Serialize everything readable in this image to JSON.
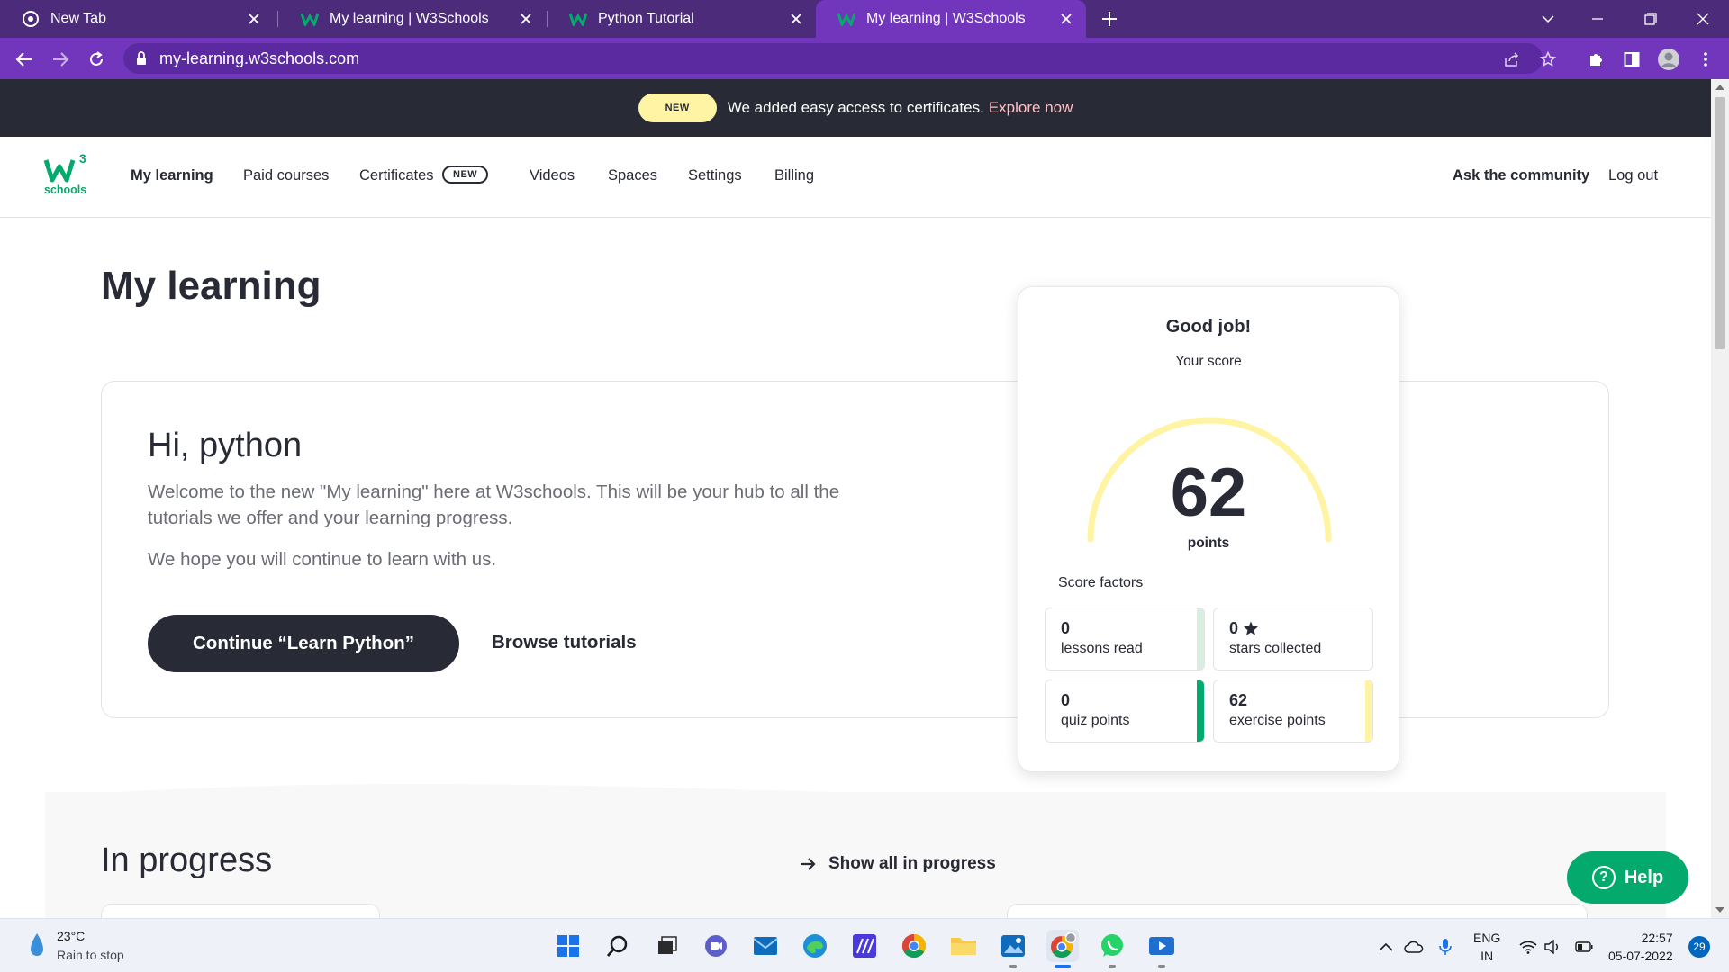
{
  "browser": {
    "tabs": [
      {
        "title": "New Tab",
        "active": false,
        "icon": "chrome-icon"
      },
      {
        "title": "My learning | W3Schools",
        "active": false,
        "icon": "w3schools-favicon"
      },
      {
        "title": "Python Tutorial",
        "active": false,
        "icon": "w3schools-favicon"
      },
      {
        "title": "My learning | W3Schools",
        "active": true,
        "icon": "w3schools-favicon"
      }
    ],
    "url": "my-learning.w3schools.com",
    "accent": "#7236bd",
    "tabbar_color": "#4c2c7a"
  },
  "banner": {
    "badge": "NEW",
    "message": "We added easy access to certificates.",
    "link": "Explore now"
  },
  "nav": {
    "logo_sup": "3",
    "logo_text": "schools",
    "items": [
      "My learning",
      "Paid courses",
      "Certificates",
      "Videos",
      "Spaces",
      "Settings",
      "Billing"
    ],
    "certificates_badge": "NEW",
    "ask": "Ask the community",
    "logout": "Log out"
  },
  "page": {
    "title": "My learning",
    "greeting": "Hi, python",
    "welcome": "Welcome to the new \"My learning\" here at W3schools. This will be your hub to all the tutorials we offer and your learning progress.",
    "hope": "We hope you will continue to learn with us.",
    "cta": "Continue “Learn Python”",
    "browse": "Browse tutorials",
    "in_progress": "In progress",
    "show_all": "Show all in progress",
    "help": "Help"
  },
  "score": {
    "heading": "Good job!",
    "label": "Your score",
    "value": "62",
    "unit": "points",
    "factors_title": "Score factors",
    "factors": [
      {
        "value": "0",
        "label": "lessons read",
        "color": "#d9eee1"
      },
      {
        "value": "0",
        "label": "stars collected",
        "color": "#ffffff"
      },
      {
        "value": "0",
        "label": "quiz points",
        "color": "#04aa6d"
      },
      {
        "value": "62",
        "label": "exercise points",
        "color": "#fff4a3"
      }
    ],
    "gauge_color": "#fff4a3"
  },
  "taskbar": {
    "temp": "23°C",
    "weather": "Rain to stop",
    "lang1": "ENG",
    "lang2": "IN",
    "time": "22:57",
    "date": "05-07-2022",
    "notifications": "29"
  }
}
